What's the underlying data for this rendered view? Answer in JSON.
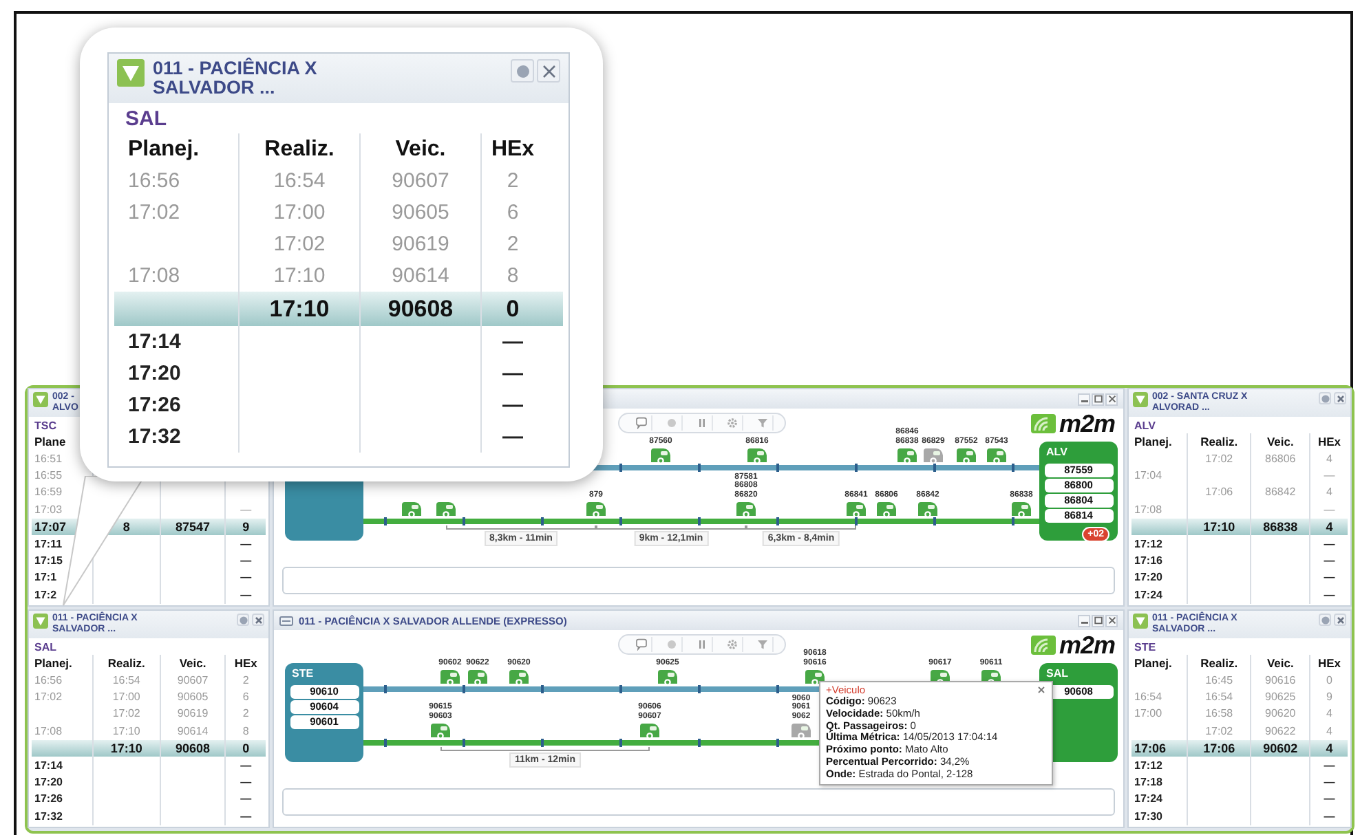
{
  "callout": {
    "title": "011 - PACIÊNCIA X\nSALVADOR ...",
    "controls": true,
    "station": "SAL",
    "columns": [
      "Planej.",
      "Realiz.",
      "Veic.",
      "HEx"
    ],
    "rows": [
      {
        "kind": "done",
        "planned": "16:56",
        "done": "16:54",
        "vehicle": "90607",
        "hex": "2"
      },
      {
        "kind": "done",
        "planned": "17:02",
        "done": "17:00",
        "vehicle": "90605",
        "hex": "6"
      },
      {
        "kind": "done",
        "done": "17:02",
        "vehicle": "90619",
        "hex": "2"
      },
      {
        "kind": "done",
        "planned": "17:08",
        "done": "17:10",
        "vehicle": "90614",
        "hex": "8"
      },
      {
        "kind": "current",
        "done": "17:10",
        "vehicle": "90608",
        "hex": "0"
      },
      {
        "kind": "planned",
        "planned": "17:14",
        "hex": "—"
      },
      {
        "kind": "planned",
        "planned": "17:20",
        "hex": "—"
      },
      {
        "kind": "planned",
        "planned": "17:26",
        "hex": "—"
      },
      {
        "kind": "planned",
        "planned": "17:32",
        "hex": "—"
      }
    ]
  },
  "top": {
    "left": {
      "title": "002 -\nALVO",
      "station": "TSC",
      "columns": [
        "Plane"
      ],
      "rows": [
        {
          "kind": "done",
          "planned": "16:51"
        },
        {
          "kind": "done",
          "planned": "16:55"
        },
        {
          "kind": "done",
          "planned": "16:59"
        },
        {
          "kind": "done",
          "planned": "17:03",
          "hex": "—"
        },
        {
          "kind": "current",
          "planned": "17:07",
          "done": "8",
          "vehicle": "87547",
          "hex": "9"
        },
        {
          "kind": "planned",
          "planned": "17:11",
          "hex": "—"
        },
        {
          "kind": "planned",
          "planned": "17:15",
          "hex": "—"
        },
        {
          "kind": "planned",
          "planned": "17:1",
          "hex": "—"
        },
        {
          "kind": "planned",
          "planned": "17:2",
          "hex": "—"
        }
      ]
    },
    "map": {
      "logo": "m2m",
      "destination": {
        "name": "ALV",
        "vehicles": [
          "87559",
          "86800",
          "86804",
          "86814"
        ],
        "badge": "+02"
      },
      "tracks": [
        {
          "groups": [
            {
              "labels": [
                "87560"
              ],
              "idle": false
            },
            {
              "labels": [
                "86816"
              ],
              "idle": false
            },
            {
              "labels": [
                "86846",
                "86838"
              ],
              "idle": false
            },
            {
              "labels": [
                "86829"
              ],
              "idle": true
            },
            {
              "labels": [
                "87552"
              ],
              "idle": false
            },
            {
              "labels": [
                "87543"
              ],
              "idle": false
            }
          ]
        },
        {
          "groups": [
            {
              "idle": false
            },
            {
              "idle": false
            },
            {
              "labels": [
                "879"
              ],
              "idle": false
            },
            {
              "labels": [
                "87581",
                "86808",
                "86820"
              ],
              "idle": false
            },
            {
              "labels": [
                "86841"
              ],
              "idle": false
            },
            {
              "labels": [
                "86806"
              ],
              "idle": false
            },
            {
              "labels": [
                "86842"
              ],
              "idle": false
            },
            {
              "labels": [
                "86838"
              ],
              "idle": false
            }
          ],
          "distances": [
            "8,3km - 11min",
            "9km - 12,1min",
            "6,3km - 8,4min"
          ]
        }
      ]
    },
    "right": {
      "title": "002 - SANTA CRUZ X\nALVORAD ...",
      "controls": true,
      "station": "ALV",
      "columns": [
        "Planej.",
        "Realiz.",
        "Veic.",
        "HEx"
      ],
      "rows": [
        {
          "kind": "done",
          "done": "17:02",
          "vehicle": "86806",
          "hex": "4"
        },
        {
          "kind": "done",
          "planned": "17:04",
          "hex": "—"
        },
        {
          "kind": "done",
          "done": "17:06",
          "vehicle": "86842",
          "hex": "4"
        },
        {
          "kind": "done",
          "planned": "17:08",
          "hex": "—"
        },
        {
          "kind": "current",
          "done": "17:10",
          "vehicle": "86838",
          "hex": "4"
        },
        {
          "kind": "planned",
          "planned": "17:12",
          "hex": "—"
        },
        {
          "kind": "planned",
          "planned": "17:16",
          "hex": "—"
        },
        {
          "kind": "planned",
          "planned": "17:20",
          "hex": "—"
        },
        {
          "kind": "planned",
          "planned": "17:24",
          "hex": "—"
        }
      ]
    }
  },
  "bottom": {
    "left": {
      "title": "011 - PACIÊNCIA X\nSALVADOR ...",
      "controls": true,
      "station": "SAL",
      "columns": [
        "Planej.",
        "Realiz.",
        "Veic.",
        "HEx"
      ],
      "rows": [
        {
          "kind": "done",
          "planned": "16:56",
          "done": "16:54",
          "vehicle": "90607",
          "hex": "2"
        },
        {
          "kind": "done",
          "planned": "17:02",
          "done": "17:00",
          "vehicle": "90605",
          "hex": "6"
        },
        {
          "kind": "done",
          "done": "17:02",
          "vehicle": "90619",
          "hex": "2"
        },
        {
          "kind": "done",
          "planned": "17:08",
          "done": "17:10",
          "vehicle": "90614",
          "hex": "8"
        },
        {
          "kind": "current",
          "done": "17:10",
          "vehicle": "90608",
          "hex": "0"
        },
        {
          "kind": "planned",
          "planned": "17:14",
          "hex": "—"
        },
        {
          "kind": "planned",
          "planned": "17:20",
          "hex": "—"
        },
        {
          "kind": "planned",
          "planned": "17:26",
          "hex": "—"
        },
        {
          "kind": "planned",
          "planned": "17:32",
          "hex": "—"
        }
      ]
    },
    "map": {
      "title": "011 - PACIÊNCIA X SALVADOR ALLENDE (EXPRESSO)",
      "logo": "m2m",
      "origin": {
        "name": "STE",
        "vehicles": [
          "90610",
          "90604",
          "90601"
        ]
      },
      "destination": {
        "name": "SAL",
        "vehicles": [
          "90608"
        ]
      },
      "tracks": [
        {
          "groups": [
            {
              "labels": [
                "90602"
              ],
              "idle": false
            },
            {
              "labels": [
                "90622"
              ],
              "idle": false
            },
            {
              "labels": [
                "90620"
              ],
              "idle": false
            },
            {
              "labels": [
                "90625"
              ],
              "idle": false
            },
            {
              "labels": [
                "90618",
                "90616"
              ],
              "idle": false
            },
            {
              "labels": [
                "90617"
              ],
              "idle": false
            },
            {
              "labels": [
                "90611"
              ],
              "idle": false
            }
          ]
        },
        {
          "groups": [
            {
              "labels": [
                "90615",
                "90603"
              ],
              "idle": false
            },
            {
              "labels": [
                "90606",
                "90607"
              ],
              "idle": false
            },
            {
              "labels": [
                "9060",
                "9061",
                "9062"
              ],
              "idle": true
            }
          ],
          "distances": [
            "11km - 12min"
          ]
        }
      ],
      "tooltip": {
        "title": "+Veiculo",
        "lines": [
          "**Código:** 90623",
          "**Velocidade:** 50km/h",
          "**Qt. Passageiros:** 0",
          "**Última Métrica:** 14/05/2013 17:04:14",
          "**Próximo ponto:** Mato Alto",
          "**Percentual Percorrido:** 34,2%",
          "**Onde:** Estrada do Pontal, 2-128"
        ]
      }
    },
    "right": {
      "title": "011 - PACIÊNCIA X\nSALVADOR ...",
      "controls": true,
      "station": "STE",
      "columns": [
        "Planej.",
        "Realiz.",
        "Veic.",
        "HEx"
      ],
      "rows": [
        {
          "kind": "done",
          "done": "16:45",
          "vehicle": "90616",
          "hex": "0"
        },
        {
          "kind": "done",
          "planned": "16:54",
          "done": "16:54",
          "vehicle": "90625",
          "hex": "9"
        },
        {
          "kind": "done",
          "planned": "17:00",
          "done": "16:58",
          "vehicle": "90620",
          "hex": "4"
        },
        {
          "kind": "done",
          "done": "17:02",
          "vehicle": "90622",
          "hex": "4"
        },
        {
          "kind": "current",
          "planned": "17:06",
          "done": "17:06",
          "vehicle": "90602",
          "hex": "4"
        },
        {
          "kind": "planned",
          "planned": "17:12",
          "hex": "—"
        },
        {
          "kind": "planned",
          "planned": "17:18",
          "hex": "—"
        },
        {
          "kind": "planned",
          "planned": "17:24",
          "hex": "—"
        },
        {
          "kind": "planned",
          "planned": "17:30",
          "hex": "—"
        }
      ]
    }
  }
}
